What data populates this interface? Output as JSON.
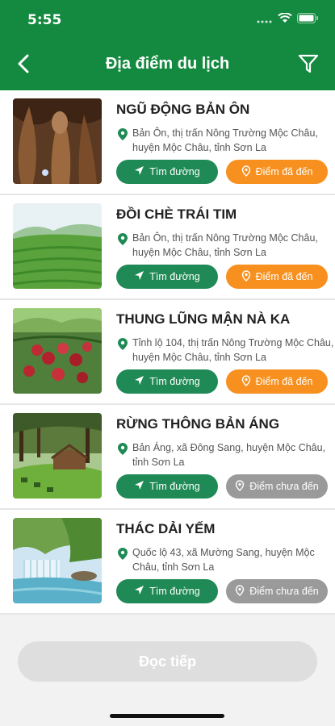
{
  "status_bar": {
    "time": "5:55"
  },
  "header": {
    "title": "Địa điểm du lịch"
  },
  "places": [
    {
      "name": "NGŨ ĐỘNG BẢN ÔN",
      "address": "Bản Ôn, thị trấn Nông Trường Mộc Châu, huyện Mộc Châu, tỉnh Sơn La",
      "route_label": "Tìm đường",
      "status_label": "Điểm đã đến",
      "visited": true,
      "image": "cave-photo"
    },
    {
      "name": "ĐỒI CHÈ TRÁI TIM",
      "address": "Bản Ôn, thị trấn Nông Trường Mộc Châu, huyện Mộc Châu, tỉnh Sơn La",
      "route_label": "Tìm đường",
      "status_label": "Điểm đã đến",
      "visited": true,
      "image": "tea-hill-photo"
    },
    {
      "name": "THUNG LŨNG MẬN NÀ KA",
      "address": "Tỉnh lộ 104, thị trấn Nông Trường Mộc Châu, huyện Mộc Châu, tỉnh Sơn La",
      "route_label": "Tìm đường",
      "status_label": "Điểm đã đến",
      "visited": true,
      "image": "plum-photo"
    },
    {
      "name": "RỪNG THÔNG BẢN ÁNG",
      "address": "Bản Áng, xã Đông Sang, huyện Mộc Châu, tỉnh Sơn La",
      "route_label": "Tìm đường",
      "status_label": "Điểm chưa đến",
      "visited": false,
      "image": "pine-forest-photo"
    },
    {
      "name": "THÁC DẢI YẾM",
      "address": "Quốc lộ 43, xã Mường Sang, huyện Mộc Châu, tỉnh Sơn La",
      "route_label": "Tìm đường",
      "status_label": "Điểm chưa đến",
      "visited": false,
      "image": "waterfall-photo"
    }
  ],
  "footer": {
    "read_more_label": "Đọc tiếp"
  },
  "colors": {
    "header_green": "#138a3f",
    "route_green": "#1f8a55",
    "visited_orange": "#f7901e",
    "not_visited_gray": "#9a9a9a"
  }
}
